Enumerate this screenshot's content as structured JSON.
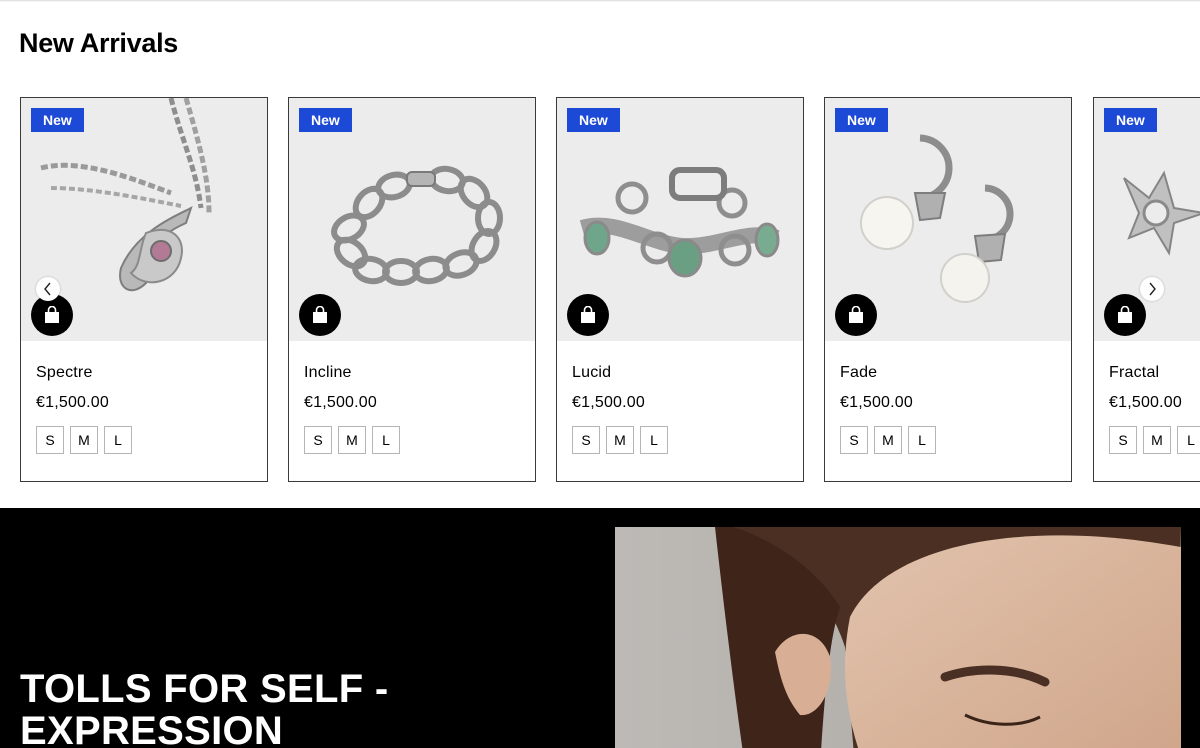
{
  "section": {
    "title": "New Arrivals"
  },
  "products": [
    {
      "name": "Spectre",
      "price": "€1,500.00",
      "badge": "New",
      "sizes": [
        "S",
        "M",
        "L"
      ],
      "image": "pendant-necklace"
    },
    {
      "name": "Incline",
      "price": "€1,500.00",
      "badge": "New",
      "sizes": [
        "S",
        "M",
        "L"
      ],
      "image": "chain-bracelet"
    },
    {
      "name": "Lucid",
      "price": "€1,500.00",
      "badge": "New",
      "sizes": [
        "S",
        "M",
        "L"
      ],
      "image": "green-stone-bracelet"
    },
    {
      "name": "Fade",
      "price": "€1,500.00",
      "badge": "New",
      "sizes": [
        "S",
        "M",
        "L"
      ],
      "image": "pearl-hoop-earrings"
    },
    {
      "name": "Fractal",
      "price": "€1,500.00",
      "badge": "New",
      "sizes": [
        "S",
        "M",
        "L"
      ],
      "image": "spiked-ring"
    }
  ],
  "gallery_nav": {
    "prev_icon": "chevron-left-icon",
    "next_icon": "chevron-right-icon"
  },
  "cart_icon": "shopping-bag-icon",
  "hero": {
    "title_line1": "TOLLS FOR SELF -",
    "title_line2": "EXPRESSION",
    "image": "woman-portrait-earring"
  },
  "colors": {
    "badge": "#1c4ad6",
    "hero_bg": "#000000",
    "card_bg": "#ececec"
  }
}
